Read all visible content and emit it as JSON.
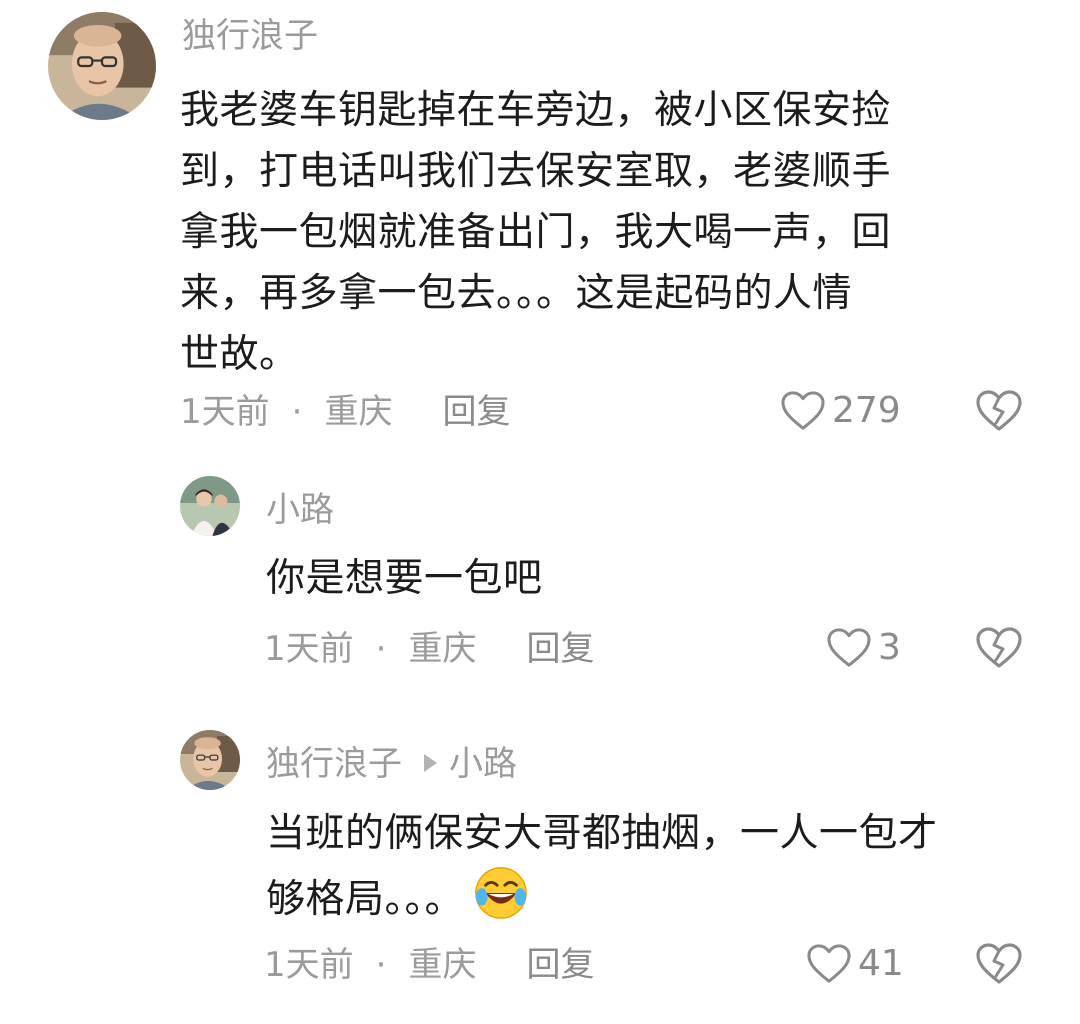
{
  "comments": [
    {
      "username": "独行浪子",
      "lines": [
        "我老婆车钥匙掉在车旁边，被小区保安捡",
        "到，打电话叫我们去保安室取，老婆顺手",
        "拿我一包烟就准备出门，我大喝一声，回",
        "来，再多拿一包去。。。这是起码的人情",
        "世故。"
      ],
      "time": "1天前",
      "location": "重庆",
      "reply_label": "回复",
      "likes": "279"
    },
    {
      "username": "小路",
      "lines": [
        "你是想要一包吧"
      ],
      "time": "1天前",
      "location": "重庆",
      "reply_label": "回复",
      "likes": "3"
    },
    {
      "username": "独行浪子",
      "reply_to": "小路",
      "lines": [
        "当班的俩保安大哥都抽烟，一人一包才",
        "够格局。。。"
      ],
      "emoji": "rofl-emoji",
      "time": "1天前",
      "location": "重庆",
      "reply_label": "回复",
      "likes": "41"
    }
  ],
  "separator": "·",
  "colors": {
    "text": "#1c1c1c",
    "muted": "#9b9b9b",
    "icon": "#8a8a8a"
  },
  "icons": {
    "like": "heart-outline-icon",
    "dislike": "broken-heart-icon",
    "reply_arrow": "triangle-right-icon"
  }
}
